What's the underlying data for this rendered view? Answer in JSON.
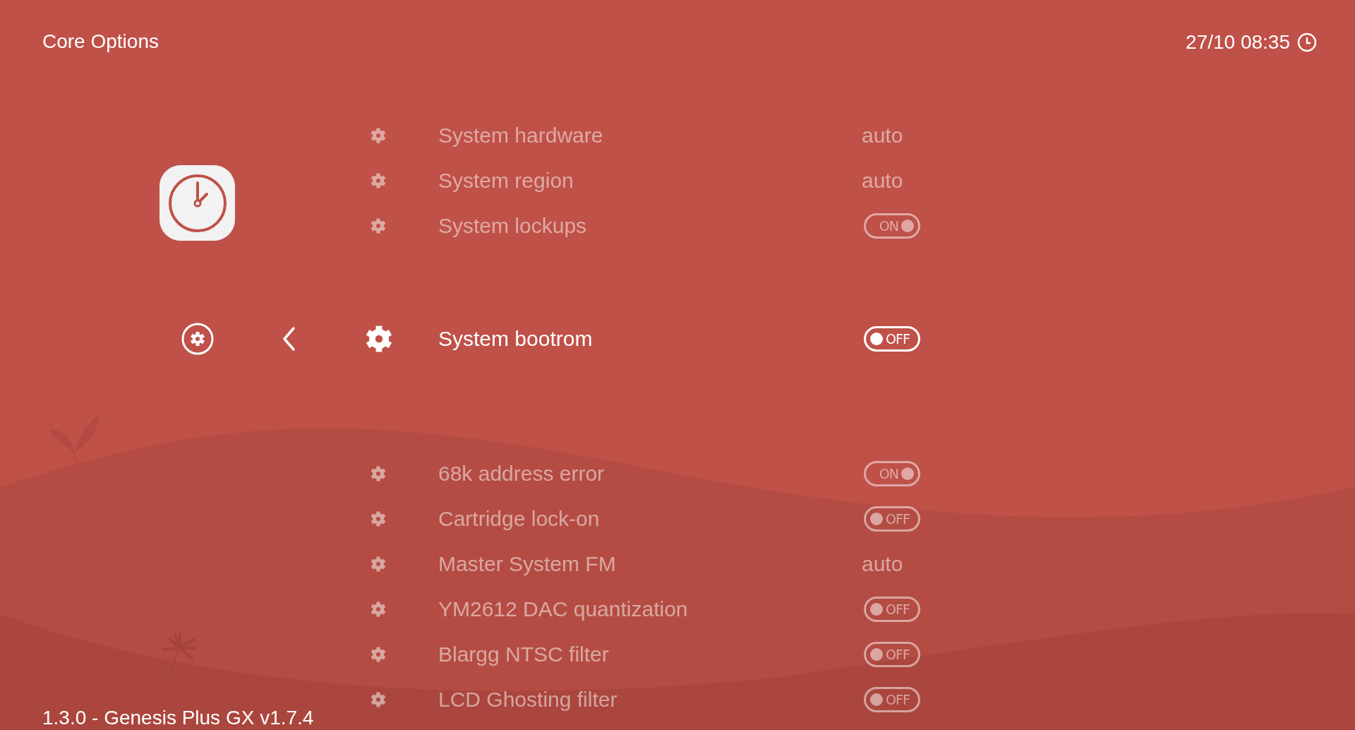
{
  "header": {
    "title": "Core Options",
    "clock": "27/10 08:35"
  },
  "options": [
    {
      "label": "System hardware",
      "kind": "text",
      "value": "auto",
      "selected": false
    },
    {
      "label": "System region",
      "kind": "text",
      "value": "auto",
      "selected": false
    },
    {
      "label": "System lockups",
      "kind": "toggle",
      "value": "ON",
      "on": true,
      "selected": false
    },
    {
      "label": "System bootrom",
      "kind": "toggle",
      "value": "OFF",
      "on": false,
      "selected": true
    },
    {
      "label": "68k address error",
      "kind": "toggle",
      "value": "ON",
      "on": true,
      "selected": false
    },
    {
      "label": "Cartridge lock-on",
      "kind": "toggle",
      "value": "OFF",
      "on": false,
      "selected": false
    },
    {
      "label": "Master System FM",
      "kind": "text",
      "value": "auto",
      "selected": false
    },
    {
      "label": "YM2612 DAC quantization",
      "kind": "toggle",
      "value": "OFF",
      "on": false,
      "selected": false
    },
    {
      "label": "Blargg NTSC filter",
      "kind": "toggle",
      "value": "OFF",
      "on": false,
      "selected": false
    },
    {
      "label": "LCD Ghosting filter",
      "kind": "toggle",
      "value": "OFF",
      "on": false,
      "selected": false
    }
  ],
  "footer": "1.3.0 - Genesis Plus GX v1.7.4"
}
